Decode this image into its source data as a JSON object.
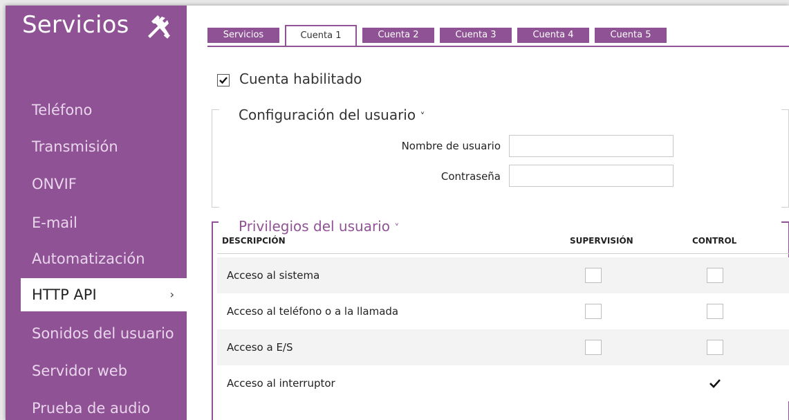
{
  "colors": {
    "accent": "#8e5295",
    "sidebar_text": "#ead6ec",
    "row_alt": "#f3f3f3"
  },
  "sidebar": {
    "title": "Servicios",
    "icon": "tools-icon",
    "items": [
      {
        "label": "Teléfono"
      },
      {
        "label": "Transmisión"
      },
      {
        "label": "ONVIF"
      },
      {
        "label": "E-mail"
      },
      {
        "label": "Automatización"
      },
      {
        "label": "HTTP API",
        "active": true,
        "chevron": "›"
      },
      {
        "label": "Sonidos del usuario"
      },
      {
        "label": "Servidor web"
      },
      {
        "label": "Prueba de audio"
      }
    ]
  },
  "tabs": [
    {
      "label": "Servicios"
    },
    {
      "label": "Cuenta 1",
      "active": true
    },
    {
      "label": "Cuenta 2"
    },
    {
      "label": "Cuenta 3"
    },
    {
      "label": "Cuenta 4"
    },
    {
      "label": "Cuenta 5"
    }
  ],
  "account": {
    "enabled_label": "Cuenta habilitado",
    "enabled": true,
    "user_config": {
      "title": "Configuración del usuario",
      "chevron": "˅",
      "username_label": "Nombre de usuario",
      "username_value": "",
      "password_label": "Contraseña",
      "password_value": ""
    },
    "privileges": {
      "title": "Privilegios del usuario",
      "chevron": "˅",
      "columns": [
        "DESCRIPCIÓN",
        "SUPERVISIÓN",
        "CONTROL"
      ],
      "rows": [
        {
          "label": "Acceso al sistema",
          "supervision": false,
          "control": false
        },
        {
          "label": "Acceso al teléfono o a la llamada",
          "supervision": false,
          "control": false
        },
        {
          "label": "Acceso a E/S",
          "supervision": false,
          "control": false
        },
        {
          "label": "Acceso al interruptor",
          "supervision": null,
          "control": true
        }
      ]
    }
  }
}
